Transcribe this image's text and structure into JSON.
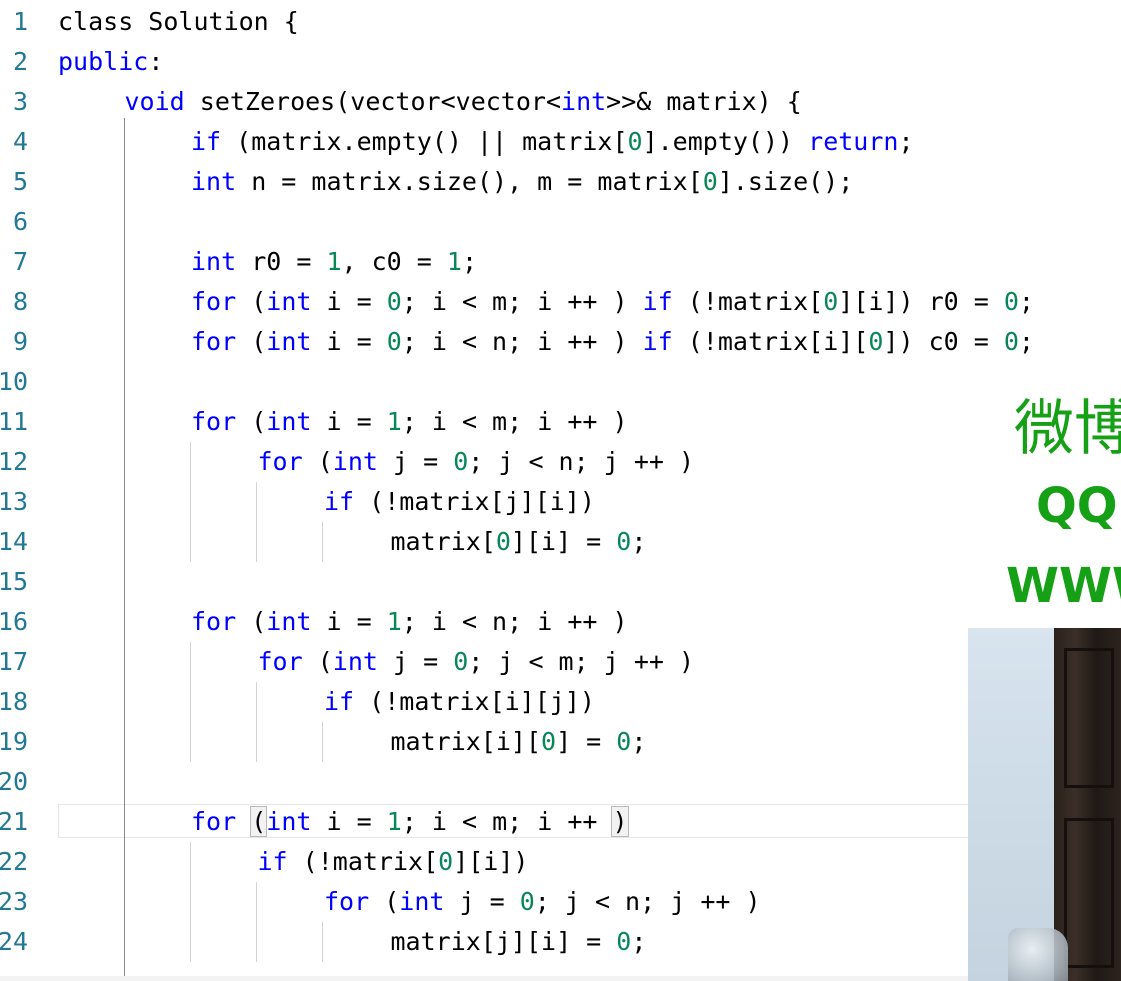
{
  "editor": {
    "current_line": 21,
    "lines": [
      {
        "n": "1",
        "indent": 0,
        "tokens": [
          [
            "kw0",
            "class Solution {"
          ]
        ]
      },
      {
        "n": "2",
        "indent": 0,
        "tokens": [
          [
            "kw",
            "public"
          ],
          [
            "txt",
            ":"
          ]
        ]
      },
      {
        "n": "3",
        "indent": 1,
        "tokens": [
          [
            "kw",
            "void"
          ],
          [
            "txt",
            " setZeroes(vector<vector<"
          ],
          [
            "kw",
            "int"
          ],
          [
            "txt",
            ">>& matrix) {"
          ]
        ]
      },
      {
        "n": "4",
        "indent": 2,
        "tokens": [
          [
            "kw",
            "if"
          ],
          [
            "txt",
            " (matrix.empty() || matrix["
          ],
          [
            "num",
            "0"
          ],
          [
            "txt",
            "].empty()) "
          ],
          [
            "kw",
            "return"
          ],
          [
            "txt",
            ";"
          ]
        ]
      },
      {
        "n": "5",
        "indent": 2,
        "tokens": [
          [
            "kw",
            "int"
          ],
          [
            "txt",
            " n = matrix.size(), m = matrix["
          ],
          [
            "num",
            "0"
          ],
          [
            "txt",
            "].size();"
          ]
        ]
      },
      {
        "n": "6",
        "indent": 0,
        "tokens": []
      },
      {
        "n": "7",
        "indent": 2,
        "tokens": [
          [
            "kw",
            "int"
          ],
          [
            "txt",
            " r0 = "
          ],
          [
            "num",
            "1"
          ],
          [
            "txt",
            ", c0 = "
          ],
          [
            "num",
            "1"
          ],
          [
            "txt",
            ";"
          ]
        ]
      },
      {
        "n": "8",
        "indent": 2,
        "tokens": [
          [
            "kw",
            "for"
          ],
          [
            "txt",
            " ("
          ],
          [
            "kw",
            "int"
          ],
          [
            "txt",
            " i = "
          ],
          [
            "num",
            "0"
          ],
          [
            "txt",
            "; i < m; i ++ ) "
          ],
          [
            "kw",
            "if"
          ],
          [
            "txt",
            " (!matrix["
          ],
          [
            "num",
            "0"
          ],
          [
            "txt",
            "][i]) r0 = "
          ],
          [
            "num",
            "0"
          ],
          [
            "txt",
            ";"
          ]
        ]
      },
      {
        "n": "9",
        "indent": 2,
        "tokens": [
          [
            "kw",
            "for"
          ],
          [
            "txt",
            " ("
          ],
          [
            "kw",
            "int"
          ],
          [
            "txt",
            " i = "
          ],
          [
            "num",
            "0"
          ],
          [
            "txt",
            "; i < n; i ++ ) "
          ],
          [
            "kw",
            "if"
          ],
          [
            "txt",
            " (!matrix[i]["
          ],
          [
            "num",
            "0"
          ],
          [
            "txt",
            "]) c0 = "
          ],
          [
            "num",
            "0"
          ],
          [
            "txt",
            ";"
          ]
        ]
      },
      {
        "n": "10",
        "indent": 0,
        "tokens": []
      },
      {
        "n": "11",
        "indent": 2,
        "tokens": [
          [
            "kw",
            "for"
          ],
          [
            "txt",
            " ("
          ],
          [
            "kw",
            "int"
          ],
          [
            "txt",
            " i = "
          ],
          [
            "num",
            "1"
          ],
          [
            "txt",
            "; i < m; i ++ )"
          ]
        ]
      },
      {
        "n": "12",
        "indent": 3,
        "tokens": [
          [
            "kw",
            "for"
          ],
          [
            "txt",
            " ("
          ],
          [
            "kw",
            "int"
          ],
          [
            "txt",
            " j = "
          ],
          [
            "num",
            "0"
          ],
          [
            "txt",
            "; j < n; j ++ )"
          ]
        ]
      },
      {
        "n": "13",
        "indent": 4,
        "tokens": [
          [
            "kw",
            "if"
          ],
          [
            "txt",
            " (!matrix[j][i])"
          ]
        ]
      },
      {
        "n": "14",
        "indent": 5,
        "tokens": [
          [
            "txt",
            "matrix["
          ],
          [
            "num",
            "0"
          ],
          [
            "txt",
            "][i] = "
          ],
          [
            "num",
            "0"
          ],
          [
            "txt",
            ";"
          ]
        ]
      },
      {
        "n": "15",
        "indent": 0,
        "tokens": []
      },
      {
        "n": "16",
        "indent": 2,
        "tokens": [
          [
            "kw",
            "for"
          ],
          [
            "txt",
            " ("
          ],
          [
            "kw",
            "int"
          ],
          [
            "txt",
            " i = "
          ],
          [
            "num",
            "1"
          ],
          [
            "txt",
            "; i < n; i ++ )"
          ]
        ]
      },
      {
        "n": "17",
        "indent": 3,
        "tokens": [
          [
            "kw",
            "for"
          ],
          [
            "txt",
            " ("
          ],
          [
            "kw",
            "int"
          ],
          [
            "txt",
            " j = "
          ],
          [
            "num",
            "0"
          ],
          [
            "txt",
            "; j < m; j ++ )"
          ]
        ]
      },
      {
        "n": "18",
        "indent": 4,
        "tokens": [
          [
            "kw",
            "if"
          ],
          [
            "txt",
            " (!matrix[i][j])"
          ]
        ]
      },
      {
        "n": "19",
        "indent": 5,
        "tokens": [
          [
            "txt",
            "matrix[i]["
          ],
          [
            "num",
            "0"
          ],
          [
            "txt",
            "] = "
          ],
          [
            "num",
            "0"
          ],
          [
            "txt",
            ";"
          ]
        ]
      },
      {
        "n": "20",
        "indent": 0,
        "tokens": []
      },
      {
        "n": "21",
        "indent": 2,
        "tokens": [
          [
            "kw",
            "for"
          ],
          [
            "txt",
            " "
          ],
          [
            "box",
            "("
          ],
          [
            "kw",
            "int"
          ],
          [
            "txt",
            " i = "
          ],
          [
            "num",
            "1"
          ],
          [
            "txt",
            "; i < m; i ++ "
          ],
          [
            "box",
            ")"
          ]
        ]
      },
      {
        "n": "22",
        "indent": 3,
        "tokens": [
          [
            "kw",
            "if"
          ],
          [
            "txt",
            " (!matrix["
          ],
          [
            "num",
            "0"
          ],
          [
            "txt",
            "][i])"
          ]
        ]
      },
      {
        "n": "23",
        "indent": 4,
        "tokens": [
          [
            "kw",
            "for"
          ],
          [
            "txt",
            " ("
          ],
          [
            "kw",
            "int"
          ],
          [
            "txt",
            " j = "
          ],
          [
            "num",
            "0"
          ],
          [
            "txt",
            "; j < n; j ++ )"
          ]
        ]
      },
      {
        "n": "24",
        "indent": 5,
        "tokens": [
          [
            "txt",
            "matrix[j][i] = "
          ],
          [
            "num",
            "0"
          ],
          [
            "txt",
            ";"
          ]
        ]
      }
    ]
  },
  "watermark": {
    "line1": "微博",
    "line2": "QQ",
    "line3": "WWW"
  },
  "colors": {
    "keyword": "#0000ff",
    "number": "#098658",
    "text": "#000000",
    "gutter": "#237893",
    "watermark": "#16a016"
  }
}
